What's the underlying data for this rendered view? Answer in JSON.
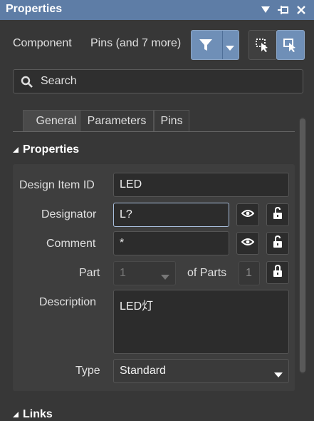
{
  "window": {
    "title": "Properties"
  },
  "filter": {
    "component_label": "Component",
    "pins_label": "Pins (and 7 more)"
  },
  "search": {
    "placeholder": "Search"
  },
  "tabs": [
    {
      "label": "General",
      "active": true
    },
    {
      "label": "Parameters",
      "active": false
    },
    {
      "label": "Pins",
      "active": false
    }
  ],
  "sections": {
    "properties": "Properties",
    "links": "Links"
  },
  "form": {
    "design_item_id": {
      "label": "Design Item ID",
      "value": "LED"
    },
    "designator": {
      "label": "Designator",
      "value": "L?"
    },
    "comment": {
      "label": "Comment",
      "value": "*"
    },
    "part": {
      "label": "Part",
      "value": "1",
      "of_parts_label": "of Parts",
      "of_parts_value": "1"
    },
    "description": {
      "label": "Description",
      "value": "LED灯"
    },
    "type": {
      "label": "Type",
      "value": "Standard"
    }
  },
  "colors": {
    "accent": "#6f8fb7",
    "titlebar": "#5e7da6",
    "background": "#373737"
  }
}
